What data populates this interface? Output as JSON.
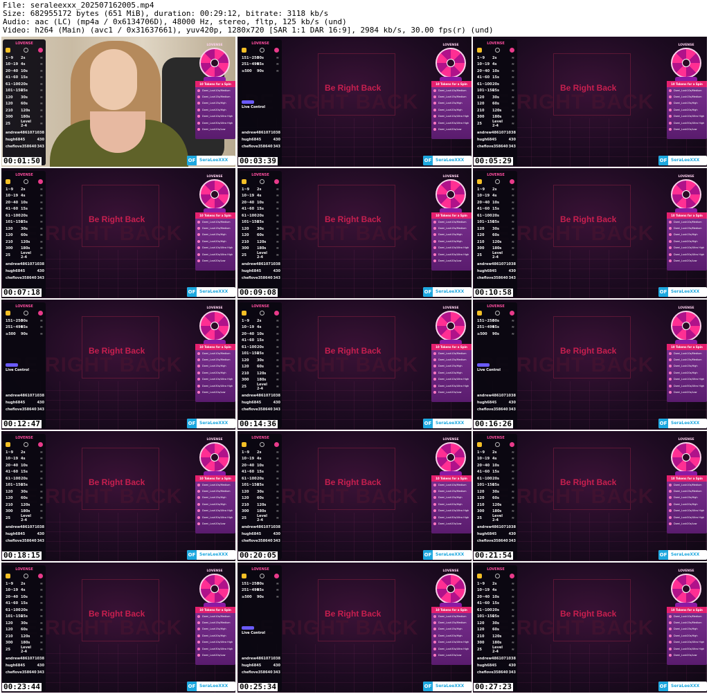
{
  "header": {
    "file_line": "File: seraleexxx_202507162005.mp4",
    "size_line": "Size: 682955172 bytes (651 MiB), duration: 00:29:12, bitrate: 3118 kb/s",
    "audio_line": "Audio: aac (LC) (mp4a / 0x6134706D), 48000 Hz, stereo, fltp, 125 kb/s (und)",
    "video_line": "Video: h264 (Main) (avc1 / 0x31637661), yuv420p, 1280x720 [SAR 1:1 DAR 16:9], 2984 kb/s, 30.00 fps(r) (und)"
  },
  "overlay": {
    "brand": "LOVENSE",
    "brb_small": "Be Right Back",
    "brb_big": "BE RIGHT BACK",
    "live_control": "Live Control",
    "spin_header": "10 Tokens for a Spin",
    "spin_options": [
      "Domi_Lush10s/Medium",
      "Domi_Lush15s/Medium",
      "Domi_Lush15s/High",
      "Domi_Lush20s/High",
      "Domi_Lush10s/Ultra High",
      "Domi_Lush30s/Ultra High",
      "Domi_Lush20s/Low"
    ],
    "of_badge": "OF",
    "of_name": "SeraLeeXXX",
    "levels": [
      {
        "range": "1~9",
        "dur": "2s"
      },
      {
        "range": "10~19",
        "dur": "4s"
      },
      {
        "range": "20~40",
        "dur": "10s"
      },
      {
        "range": "41~60",
        "dur": "15s"
      },
      {
        "range": "61~100",
        "dur": "20s"
      },
      {
        "range": "101~150",
        "dur": "25s"
      },
      {
        "range": "120",
        "dur": "30s"
      },
      {
        "range": "120",
        "dur": "60s"
      },
      {
        "range": "210",
        "dur": "120s"
      },
      {
        "range": "300",
        "dur": "180s"
      },
      {
        "range": "25",
        "dur": "Level 2-4"
      }
    ],
    "levels_alt": [
      {
        "range": "151~250",
        "dur": "30s"
      },
      {
        "range": "251~499",
        "dur": "45s"
      },
      {
        "range": "≥500",
        "dur": "90s"
      }
    ],
    "tippers": [
      {
        "name": "andrew486107",
        "value": "1038"
      },
      {
        "name": "hugh6845",
        "value": "430"
      },
      {
        "name": "cheflove358640",
        "value": "343"
      }
    ]
  },
  "thumbnails": [
    {
      "time": "00:01:50",
      "kind": "cam"
    },
    {
      "time": "00:03:39",
      "kind": "brb-alt"
    },
    {
      "time": "00:05:29",
      "kind": "brb"
    },
    {
      "time": "00:07:18",
      "kind": "brb"
    },
    {
      "time": "00:09:08",
      "kind": "brb"
    },
    {
      "time": "00:10:58",
      "kind": "brb"
    },
    {
      "time": "00:12:47",
      "kind": "brb-alt"
    },
    {
      "time": "00:14:36",
      "kind": "brb"
    },
    {
      "time": "00:16:26",
      "kind": "brb-alt"
    },
    {
      "time": "00:18:15",
      "kind": "brb"
    },
    {
      "time": "00:20:05",
      "kind": "brb"
    },
    {
      "time": "00:21:54",
      "kind": "brb"
    },
    {
      "time": "00:23:44",
      "kind": "brb"
    },
    {
      "time": "00:25:34",
      "kind": "brb-alt"
    },
    {
      "time": "00:27:23",
      "kind": "brb"
    }
  ]
}
